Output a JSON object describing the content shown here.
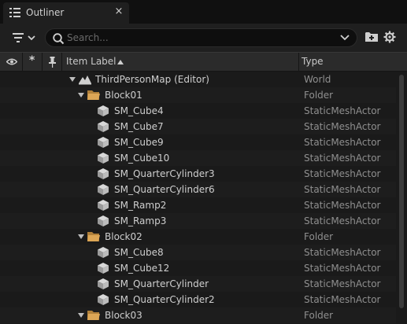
{
  "tab": {
    "title": "Outliner",
    "close": "×"
  },
  "search": {
    "placeholder": "Search..."
  },
  "columns": {
    "item_label": "Item Label",
    "type": "Type"
  },
  "rows": [
    {
      "label": "ThirdPersonMap (Editor)",
      "type": "World",
      "kind": "world",
      "level": 0,
      "expanded": true
    },
    {
      "label": "Block01",
      "type": "Folder",
      "kind": "folder",
      "level": 1,
      "expanded": true
    },
    {
      "label": "SM_Cube4",
      "type": "StaticMeshActor",
      "kind": "mesh",
      "level": 2
    },
    {
      "label": "SM_Cube7",
      "type": "StaticMeshActor",
      "kind": "mesh",
      "level": 2
    },
    {
      "label": "SM_Cube9",
      "type": "StaticMeshActor",
      "kind": "mesh",
      "level": 2
    },
    {
      "label": "SM_Cube10",
      "type": "StaticMeshActor",
      "kind": "mesh",
      "level": 2
    },
    {
      "label": "SM_QuarterCylinder3",
      "type": "StaticMeshActor",
      "kind": "mesh",
      "level": 2
    },
    {
      "label": "SM_QuarterCylinder6",
      "type": "StaticMeshActor",
      "kind": "mesh",
      "level": 2
    },
    {
      "label": "SM_Ramp2",
      "type": "StaticMeshActor",
      "kind": "mesh",
      "level": 2
    },
    {
      "label": "SM_Ramp3",
      "type": "StaticMeshActor",
      "kind": "mesh",
      "level": 2
    },
    {
      "label": "Block02",
      "type": "Folder",
      "kind": "folder",
      "level": 1,
      "expanded": true
    },
    {
      "label": "SM_Cube8",
      "type": "StaticMeshActor",
      "kind": "mesh",
      "level": 2
    },
    {
      "label": "SM_Cube12",
      "type": "StaticMeshActor",
      "kind": "mesh",
      "level": 2
    },
    {
      "label": "SM_QuarterCylinder",
      "type": "StaticMeshActor",
      "kind": "mesh",
      "level": 2
    },
    {
      "label": "SM_QuarterCylinder2",
      "type": "StaticMeshActor",
      "kind": "mesh",
      "level": 2
    },
    {
      "label": "Block03",
      "type": "Folder",
      "kind": "folder",
      "level": 1,
      "expanded": true
    }
  ]
}
